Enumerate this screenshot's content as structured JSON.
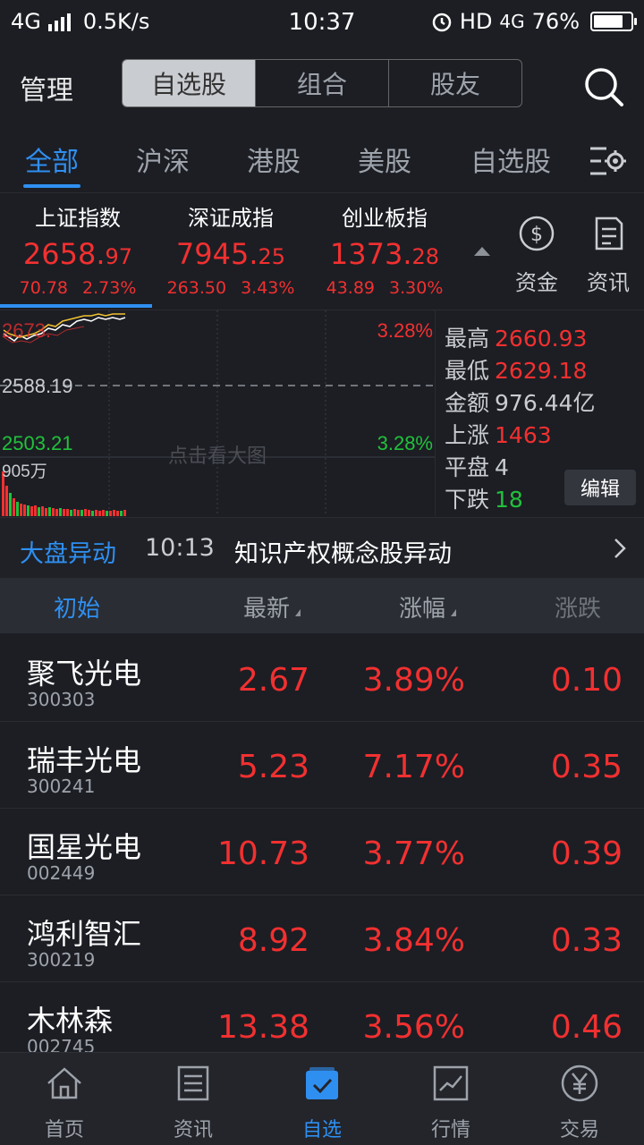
{
  "status_bar": {
    "network": "4G",
    "speed": "0.5K/s",
    "time": "10:37",
    "hd": "HD",
    "net2": "4G",
    "battery": "76%"
  },
  "header": {
    "manage": "管理",
    "segments": [
      "自选股",
      "组合",
      "股友"
    ],
    "selected_segment": "自选股"
  },
  "tabs": {
    "items": [
      "全部",
      "沪深",
      "港股",
      "美股",
      "自选股"
    ],
    "active": "全部"
  },
  "indices": [
    {
      "name": "上证指数",
      "int": "2658.",
      "dec": "97",
      "change": "70.78",
      "pct": "2.73%"
    },
    {
      "name": "深证成指",
      "int": "7945.",
      "dec": "25",
      "change": "263.50",
      "pct": "3.43%"
    },
    {
      "name": "创业板指",
      "int": "1373.",
      "dec": "28",
      "change": "43.89",
      "pct": "3.30%"
    }
  ],
  "quick_buttons": {
    "funds": "资金",
    "news": "资讯"
  },
  "chart": {
    "top_price": "2673.",
    "mid_price": "2588.19",
    "bottom_price": "2503.21",
    "top_pct": "3.28%",
    "bottom_pct": "3.28%",
    "volume": "905万",
    "hint": "点击看大图"
  },
  "stats": {
    "high_label": "最高",
    "high": "2660.93",
    "low_label": "最低",
    "low": "2629.18",
    "amount_label": "金额",
    "amount": "976.44亿",
    "up_label": "上涨",
    "up": "1463",
    "flat_label": "平盘",
    "flat": "4",
    "down_label": "下跌",
    "down": "18",
    "edit": "编辑"
  },
  "alert": {
    "label": "大盘异动",
    "time": "10:13",
    "message": "知识产权概念股异动"
  },
  "list_header": {
    "col1": "初始",
    "col2": "最新",
    "col3": "涨幅",
    "col4": "涨跌"
  },
  "stocks": [
    {
      "name": "聚飞光电",
      "code": "300303",
      "price": "2.67",
      "pct": "3.89%",
      "change": "0.10"
    },
    {
      "name": "瑞丰光电",
      "code": "300241",
      "price": "5.23",
      "pct": "7.17%",
      "change": "0.35"
    },
    {
      "name": "国星光电",
      "code": "002449",
      "price": "10.73",
      "pct": "3.77%",
      "change": "0.39"
    },
    {
      "name": "鸿利智汇",
      "code": "300219",
      "price": "8.92",
      "pct": "3.84%",
      "change": "0.33"
    },
    {
      "name": "木林森",
      "code": "002745",
      "price": "13.38",
      "pct": "3.56%",
      "change": "0.46"
    }
  ],
  "bottom_nav": [
    "首页",
    "资讯",
    "自选",
    "行情",
    "交易"
  ],
  "colors": {
    "up": "#f23030",
    "down": "#21c13b",
    "accent": "#2f8ff0",
    "background": "#1c1e24"
  }
}
